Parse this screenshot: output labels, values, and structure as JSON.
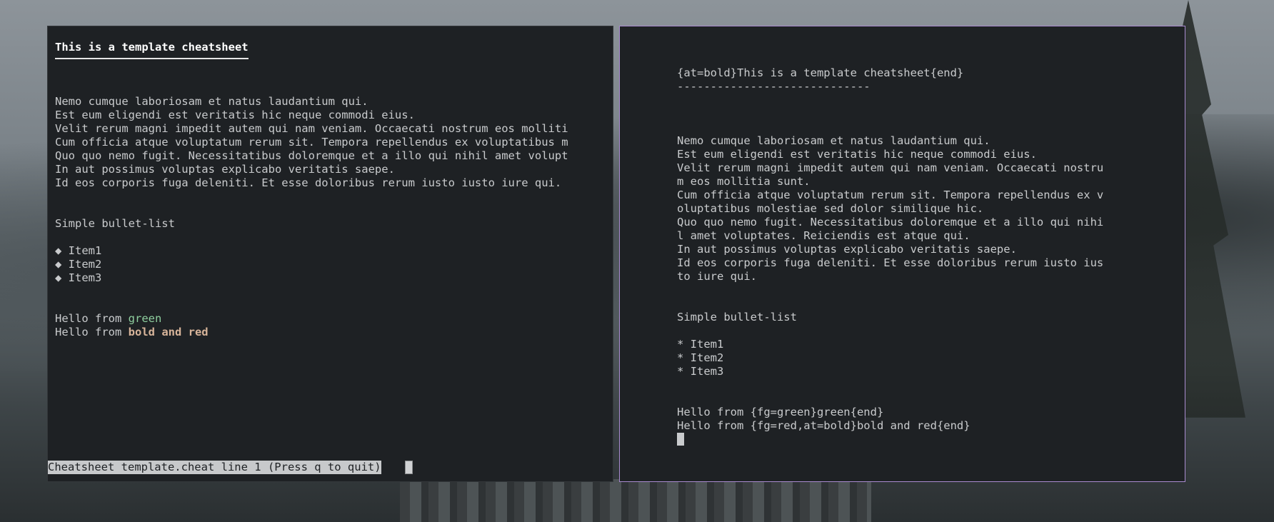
{
  "left_terminal": {
    "heading": "This is a template cheatsheet",
    "paragraph": [
      "Nemo cumque laboriosam et natus laudantium qui.",
      "Est eum eligendi est veritatis hic neque commodi eius.",
      "Velit rerum magni impedit autem qui nam veniam. Occaecati nostrum eos molliti",
      "Cum officia atque voluptatum rerum sit. Tempora repellendus ex voluptatibus m",
      "Quo quo nemo fugit. Necessitatibus doloremque et a illo qui nihil amet volupt",
      "In aut possimus voluptas explicabo veritatis saepe.",
      "Id eos corporis fuga deleniti. Et esse doloribus rerum iusto iusto iure qui."
    ],
    "list_title": "Simple bullet-list",
    "bullets": [
      "◆ Item1",
      "◆ Item2",
      "◆ Item3"
    ],
    "hello_prefix": "Hello from ",
    "hello_green": "green",
    "hello_boldred": "bold and red",
    "status_line": "Cheatsheet template.cheat line 1 (Press q to quit)"
  },
  "right_terminal": {
    "lines": [
      "{at=bold}This is a template cheatsheet{end}",
      "-----------------------------",
      "",
      "",
      "",
      "Nemo cumque laboriosam et natus laudantium qui.",
      "Est eum eligendi est veritatis hic neque commodi eius.",
      "Velit rerum magni impedit autem qui nam veniam. Occaecati nostru",
      "m eos mollitia sunt.",
      "Cum officia atque voluptatum rerum sit. Tempora repellendus ex v",
      "oluptatibus molestiae sed dolor similique hic.",
      "Quo quo nemo fugit. Necessitatibus doloremque et a illo qui nihi",
      "l amet voluptates. Reiciendis est atque qui.",
      "In aut possimus voluptas explicabo veritatis saepe.",
      "Id eos corporis fuga deleniti. Et esse doloribus rerum iusto ius",
      "to iure qui.",
      "",
      "",
      "Simple bullet-list",
      "",
      "* Item1",
      "* Item2",
      "* Item3",
      "",
      "",
      "Hello from {fg=green}green{end}",
      "Hello from {fg=red,at=bold}bold and red{end}"
    ]
  },
  "colors": {
    "terminal_bg": "#1e2124",
    "text": "#c9cbcd",
    "green": "#8fcf9f",
    "bold_red": "#d7b49a",
    "focused_border": "#a98bd0"
  }
}
